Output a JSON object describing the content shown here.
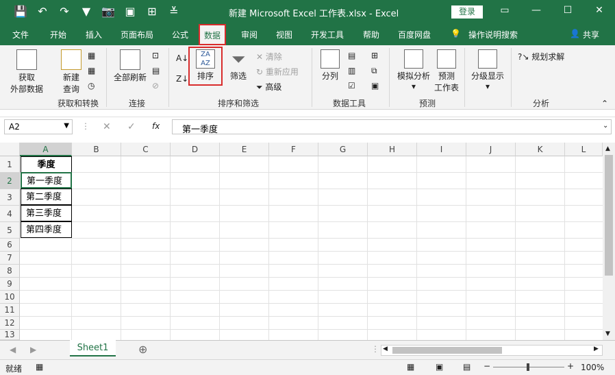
{
  "window": {
    "title": "新建 Microsoft Excel 工作表.xlsx  -  Excel",
    "login_label": "登录",
    "controls": [
      "▭",
      "—",
      "☐",
      "✕"
    ]
  },
  "qat": [
    "💾",
    "↶",
    "↷",
    "▼",
    "📷",
    "▣",
    "⊞",
    "≚"
  ],
  "tabs": [
    "文件",
    "开始",
    "插入",
    "页面布局",
    "公式",
    "数据",
    "审阅",
    "视图",
    "开发工具",
    "帮助",
    "百度网盘",
    "操作说明搜索",
    "共享"
  ],
  "active_tab": "数据",
  "ribbon": {
    "get_data_line1": "获取",
    "get_data_line2": "外部数据",
    "new_query_line1": "新建",
    "new_query_line2": "查询",
    "group_get_transform": "获取和转换",
    "refresh_all": "全部刷新",
    "group_connections": "连接",
    "sort": "排序",
    "filter": "筛选",
    "clear": "清除",
    "reapply": "重新应用",
    "advanced": "高级",
    "group_sort_filter": "排序和筛选",
    "text_to_columns": "分列",
    "group_data_tools": "数据工具",
    "what_if_line1": "模拟分析",
    "forecast_line1": "预测",
    "forecast_line2": "工作表",
    "group_forecast": "预测",
    "outline": "分级显示",
    "solver": "规划求解",
    "group_analysis": "分析"
  },
  "formula_bar": {
    "name_box": "A2",
    "fx": "fx",
    "content": "第一季度"
  },
  "columns": [
    "A",
    "B",
    "C",
    "D",
    "E",
    "F",
    "G",
    "H",
    "I",
    "J",
    "K",
    "L"
  ],
  "rows": [
    "1",
    "2",
    "3",
    "4",
    "5",
    "6",
    "7",
    "8",
    "9",
    "10",
    "11",
    "12",
    "13"
  ],
  "cells": {
    "A1": "季度",
    "A2": "第一季度",
    "A3": "第二季度",
    "A4": "第三季度",
    "A5": "第四季度"
  },
  "sheet_tab": "Sheet1",
  "status": {
    "ready": "就绪",
    "zoom": "100%"
  },
  "colors": {
    "excel_green": "#217346",
    "highlight_red": "#d82b2b"
  }
}
